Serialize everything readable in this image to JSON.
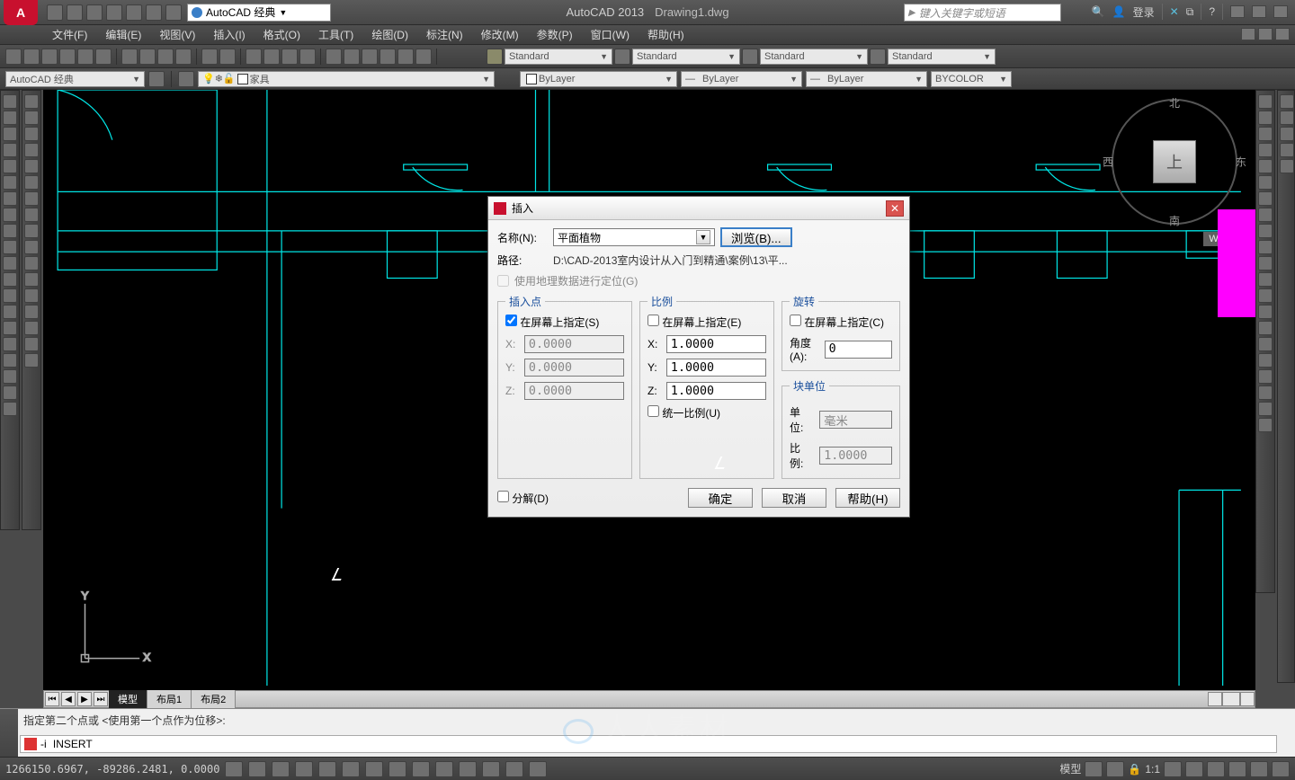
{
  "qat": {
    "workspace_label": "AutoCAD 经典",
    "app_title": "AutoCAD 2013",
    "doc_title": "Drawing1.dwg",
    "search_placeholder": "键入关键字或短语",
    "login_label": "登录"
  },
  "menu": {
    "items": [
      "文件(F)",
      "编辑(E)",
      "视图(V)",
      "插入(I)",
      "格式(O)",
      "工具(T)",
      "绘图(D)",
      "标注(N)",
      "修改(M)",
      "参数(P)",
      "窗口(W)",
      "帮助(H)"
    ]
  },
  "toolbar": {
    "styleA": "Standard",
    "styleB": "Standard",
    "styleC": "Standard",
    "styleD": "Standard",
    "layer_current": "ByLayer",
    "linetype": "ByLayer",
    "lineweight": "ByLayer",
    "plotstyle": "BYCOLOR",
    "workspace": "AutoCAD 经典",
    "layer_list": "家具"
  },
  "viewcube": {
    "n": "北",
    "s": "南",
    "e": "东",
    "w": "西",
    "top": "上",
    "wcs": "WCS"
  },
  "tabs": {
    "model": "模型",
    "layout1": "布局1",
    "layout2": "布局2"
  },
  "cmd": {
    "history": "指定第二个点或 <使用第一个点作为位移>:",
    "prefix": "-i",
    "text": "INSERT"
  },
  "status": {
    "coords": "1266150.6967, -89286.2481, 0.0000",
    "model": "模型",
    "scale": "1:1"
  },
  "dialog": {
    "title": "插入",
    "name_label": "名称(N):",
    "name_value": "平面植物",
    "browse": "浏览(B)...",
    "path_label": "路径:",
    "path_value": "D:\\CAD-2013室内设计从入门到精通\\案例\\13\\平...",
    "geo_label": "使用地理数据进行定位(G)",
    "insert_legend": "插入点",
    "insert_onscreen": "在屏幕上指定(S)",
    "x": "X:",
    "y": "Y:",
    "z": "Z:",
    "zero": "0.0000",
    "scale_legend": "比例",
    "scale_onscreen": "在屏幕上指定(E)",
    "one": "1.0000",
    "uniform": "统一比例(U)",
    "rot_legend": "旋转",
    "rot_onscreen": "在屏幕上指定(C)",
    "angle_label": "角度(A):",
    "angle_val": "0",
    "unit_legend": "块单位",
    "unit_label": "单位:",
    "unit_val": "毫米",
    "unit_scale_label": "比例:",
    "unit_scale_val": "1.0000",
    "explode": "分解(D)",
    "ok": "确定",
    "cancel": "取消",
    "help": "帮助(H)"
  },
  "watermark": "人人素材"
}
